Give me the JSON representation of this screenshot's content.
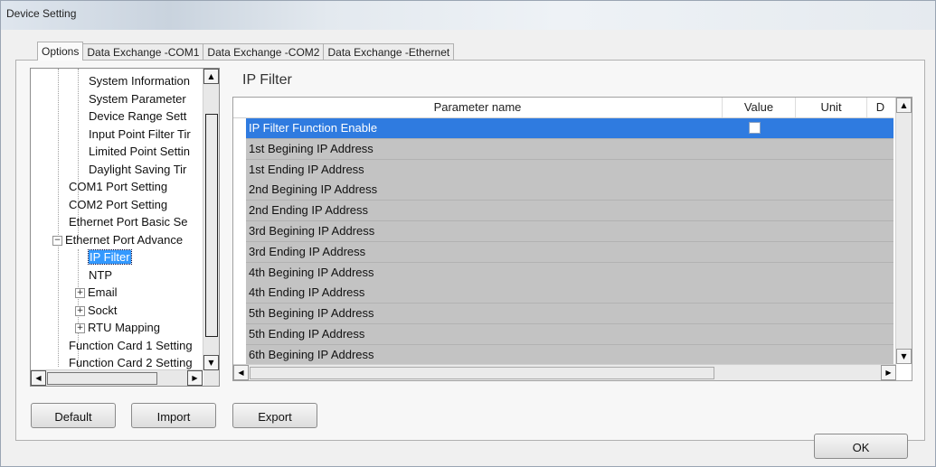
{
  "window": {
    "title": "Device Setting"
  },
  "tabs": [
    {
      "label": "Options",
      "active": true
    },
    {
      "label": "Data Exchange -COM1",
      "active": false
    },
    {
      "label": "Data Exchange -COM2",
      "active": false
    },
    {
      "label": "Data Exchange -Ethernet",
      "active": false
    }
  ],
  "tree": {
    "items": [
      {
        "label": "System Information"
      },
      {
        "label": "System Parameter"
      },
      {
        "label": "Device Range Sett"
      },
      {
        "label": "Input Point Filter Tir"
      },
      {
        "label": "Limited Point Settin"
      },
      {
        "label": "Daylight Saving Tir"
      },
      {
        "label": "COM1 Port Setting"
      },
      {
        "label": "COM2 Port Setting"
      },
      {
        "label": "Ethernet Port Basic Se"
      },
      {
        "label": "Ethernet Port Advance",
        "expander": "−"
      },
      {
        "label": "IP Filter",
        "selected": true
      },
      {
        "label": "NTP"
      },
      {
        "label": "Email",
        "expander": "+"
      },
      {
        "label": "Sockt",
        "expander": "+"
      },
      {
        "label": "RTU Mapping",
        "expander": "+"
      },
      {
        "label": "Function Card 1 Setting"
      },
      {
        "label": "Function Card 2 Setting"
      }
    ]
  },
  "panel": {
    "title": "IP Filter"
  },
  "grid": {
    "columns": [
      "Parameter name",
      "Value",
      "Unit",
      "D"
    ],
    "rows": [
      {
        "name": "IP Filter Function Enable",
        "selected": true,
        "checkbox": true
      },
      {
        "name": "1st Begining IP Address"
      },
      {
        "name": "1st Ending IP Address"
      },
      {
        "name": "2nd Begining IP Address"
      },
      {
        "name": "2nd Ending IP Address"
      },
      {
        "name": "3rd Begining IP Address"
      },
      {
        "name": "3rd Ending IP Address"
      },
      {
        "name": "4th Begining IP Address"
      },
      {
        "name": "4th Ending IP Address"
      },
      {
        "name": "5th Begining IP Address"
      },
      {
        "name": "5th Ending IP Address"
      },
      {
        "name": "6th Begining IP Address"
      }
    ]
  },
  "buttons": {
    "default": "Default",
    "import": "Import",
    "export": "Export",
    "ok": "OK"
  },
  "icons": {
    "scroll_up": "▲",
    "scroll_down": "▼",
    "scroll_left": "◀",
    "scroll_right": "▶"
  },
  "colors": {
    "selection": "#2f7be0",
    "row_bg": "#c3c3c3",
    "tree_selection": "#3399ff"
  }
}
